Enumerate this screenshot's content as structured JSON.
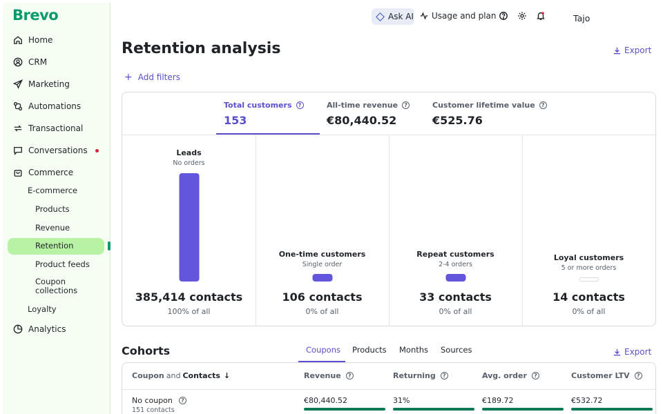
{
  "brand": {
    "logo_text": "Brevo",
    "accent": "#0b996e",
    "primary": "#5a4fcf"
  },
  "sidebar": {
    "items": [
      {
        "label": "Home",
        "icon": "home-icon"
      },
      {
        "label": "CRM",
        "icon": "contact-icon"
      },
      {
        "label": "Marketing",
        "icon": "send-icon"
      },
      {
        "label": "Automations",
        "icon": "automation-icon"
      },
      {
        "label": "Transactional",
        "icon": "repeat-icon"
      },
      {
        "label": "Conversations",
        "icon": "chat-icon"
      },
      {
        "label": "Commerce",
        "icon": "bag-icon"
      }
    ],
    "commerce_group": "E-commerce",
    "sub_items": [
      {
        "label": "Products"
      },
      {
        "label": "Revenue"
      },
      {
        "label": "Retention"
      },
      {
        "label": "Product feeds"
      },
      {
        "label": "Coupon\ncollections"
      }
    ],
    "loyalty": "Loyalty",
    "analytics": "Analytics"
  },
  "topbar": {
    "ask_ai": "Ask AI",
    "usage": "Usage and plan",
    "user": "Tajo"
  },
  "header": {
    "title": "Retention analysis",
    "export": "Export",
    "add_filters": "Add filters"
  },
  "metrics": [
    {
      "label": "Total customers",
      "value": "153",
      "active": true
    },
    {
      "label": "All-time revenue",
      "value": "€80,440.52"
    },
    {
      "label": "Customer lifetime value",
      "value": "€525.76"
    }
  ],
  "segments": [
    {
      "name": "Leads",
      "sub": "No orders",
      "count": "385,414 contacts",
      "pct": "100% of all",
      "share": 1.0
    },
    {
      "name": "One-time customers",
      "sub": "Single order",
      "count": "106 contacts",
      "pct": "0% of all",
      "share": 0.0003
    },
    {
      "name": "Repeat customers",
      "sub": "2-4 orders",
      "count": "33 contacts",
      "pct": "0% of all",
      "share": 0.0001
    },
    {
      "name": "Loyal customers",
      "sub": "5 or more orders",
      "count": "14 contacts",
      "pct": "0% of all",
      "share": 0
    }
  ],
  "cohorts": {
    "title": "Cohorts",
    "tabs": [
      "Coupons",
      "Products",
      "Months",
      "Sources"
    ],
    "export": "Export",
    "headers": {
      "group_prefix": "Coupon",
      "group_and": "and",
      "group_main": "Contacts",
      "revenue": "Revenue",
      "returning": "Returning",
      "avg_order": "Avg. order",
      "ltv": "Customer LTV"
    },
    "rows": [
      {
        "name": "No coupon",
        "sub": "151 contacts",
        "revenue": "€80,440.52",
        "returning": "31%",
        "avg_order": "€189.72",
        "ltv": "€532.72",
        "revenue_fill": 1.0,
        "returning_fill": 1.0,
        "avg_order_fill": 1.0,
        "ltv_fill": 1.0
      }
    ]
  }
}
